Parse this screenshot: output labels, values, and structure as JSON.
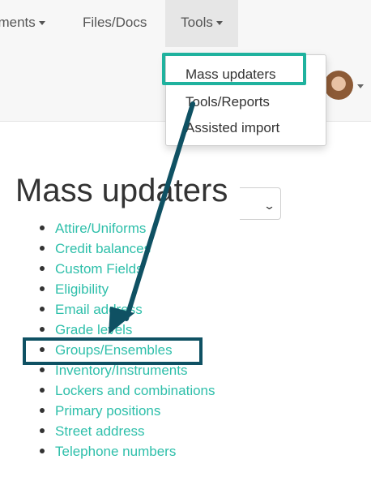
{
  "navbar": {
    "items": [
      {
        "label": "nments",
        "has_caret": true
      },
      {
        "label": "Files/Docs",
        "has_caret": false
      },
      {
        "label": "Tools",
        "has_caret": true,
        "active": true
      }
    ]
  },
  "tools_menu": {
    "items": [
      {
        "label": "Mass updaters"
      },
      {
        "label": "Tools/Reports"
      },
      {
        "label": "Assisted import"
      }
    ]
  },
  "page": {
    "title": "Mass updaters"
  },
  "updaters": [
    {
      "label": "Attire/Uniforms"
    },
    {
      "label": "Credit balances"
    },
    {
      "label": "Custom Fields"
    },
    {
      "label": "Eligibility"
    },
    {
      "label": "Email address"
    },
    {
      "label": "Grade levels"
    },
    {
      "label": "Groups/Ensembles"
    },
    {
      "label": "Inventory/Instruments"
    },
    {
      "label": "Lockers and combinations"
    },
    {
      "label": "Primary positions"
    },
    {
      "label": "Street address"
    },
    {
      "label": "Telephone numbers"
    }
  ],
  "icons": {
    "user_avatar": "user-avatar",
    "select_chevron": "chevron-down-icon"
  },
  "colors": {
    "link": "#2ebfaa",
    "highlight_teal": "#1fb29e",
    "highlight_navy": "#0f5163",
    "navbar_bg": "#f7f7f7"
  }
}
